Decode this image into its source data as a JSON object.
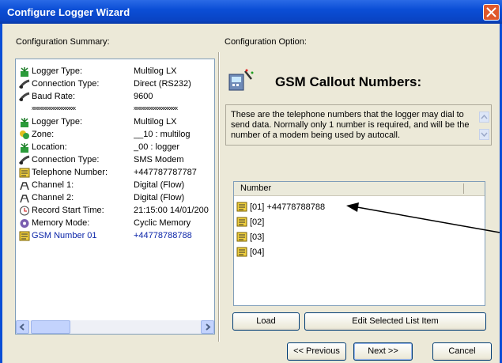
{
  "window": {
    "title": "Configure Logger Wizard"
  },
  "left_panel": {
    "label": "Configuration Summary:",
    "rows": [
      {
        "icon": "logger-antenna-icon",
        "key": "Logger Type:",
        "value": "Multilog LX"
      },
      {
        "icon": "phone-connection-icon",
        "key": "Connection Type:",
        "value": "Direct (RS232)"
      },
      {
        "icon": "phone-connection-icon",
        "key": "Baud Rate:",
        "value": "9600"
      },
      {
        "icon": "",
        "key": "xxxxxxxxxxxxxxxxxxxxxx",
        "value": "xxxxxxxxxxxxxxxxxxxxxx"
      },
      {
        "icon": "logger-antenna-icon",
        "key": "Logger Type:",
        "value": "Multilog LX"
      },
      {
        "icon": "zone-icon",
        "key": "Zone:",
        "value": "__10 : multilog"
      },
      {
        "icon": "logger-antenna-icon",
        "key": "Location:",
        "value": "_00 : logger"
      },
      {
        "icon": "phone-connection-icon",
        "key": "Connection Type:",
        "value": "SMS Modem"
      },
      {
        "icon": "phone-book-icon",
        "key": "Telephone Number:",
        "value": "+447787787787"
      },
      {
        "icon": "channel-icon",
        "key": "Channel 1:",
        "value": "Digital (Flow)"
      },
      {
        "icon": "channel-icon",
        "key": "Channel 2:",
        "value": "Digital (Flow)"
      },
      {
        "icon": "clock-icon",
        "key": "Record Start Time:",
        "value": "21:15:00 14/01/200"
      },
      {
        "icon": "memory-icon",
        "key": "Memory Mode:",
        "value": "Cyclic Memory"
      },
      {
        "icon": "phone-book-icon",
        "key": "GSM Number 01",
        "value": "+44778788788"
      }
    ]
  },
  "right_panel": {
    "label": "Configuration Option:",
    "heading": "GSM Callout Numbers:",
    "description": "These are the telephone numbers that the logger may dial to send data. Normally only 1 number is required, and will be the number of a modem being used by autocall.",
    "list_header": "Number",
    "items": [
      "[01] +44778788788",
      "[02]",
      "[03]",
      "[04]"
    ],
    "load_label": "Load",
    "edit_label": "Edit Selected List Item"
  },
  "footer": {
    "previous_label": "<< Previous",
    "next_label": "Next >>",
    "cancel_label": "Cancel"
  }
}
